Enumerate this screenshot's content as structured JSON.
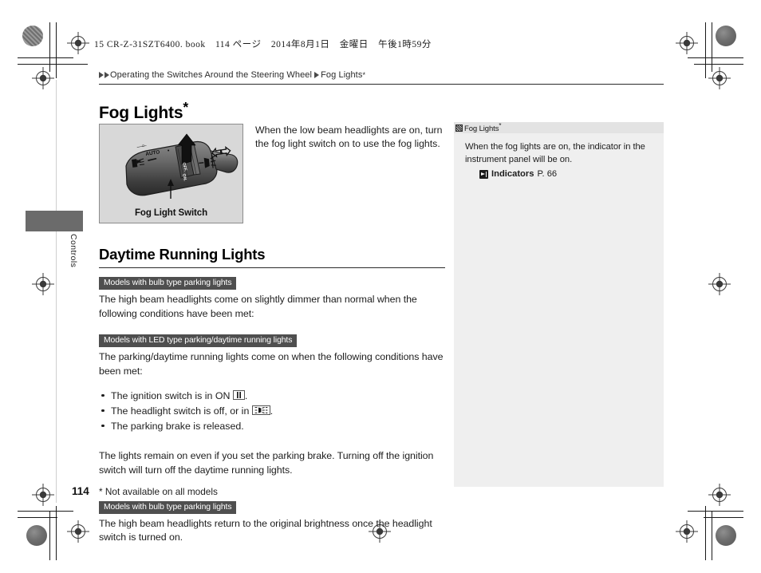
{
  "header": {
    "file_line": "15 CR-Z-31SZT6400. book   114 ページ   2014年8月1日   金曜日   午後1時59分",
    "segments": [
      "15 CR-Z-31SZT6400. book",
      "114 ページ",
      "2014年8月1日",
      "金曜日",
      "午後1時59分"
    ]
  },
  "breadcrumb": {
    "parent": "Operating the Switches Around the Steering Wheel",
    "current": "Fog Lights",
    "asterisk": "*"
  },
  "main": {
    "title": "Fog Lights",
    "title_asterisk": "*",
    "intro": "When the low beam headlights are on, turn the fog light switch on to use the fog lights.",
    "figure_caption": "Fog Light Switch",
    "figure_labels": [
      "AUTO",
      "OFF",
      "ON"
    ],
    "section2_title": "Daytime Running Lights",
    "badge_bulb": "Models with bulb type parking lights",
    "para_bulb": "The high beam headlights come on slightly dimmer than normal when the following conditions have been met:",
    "badge_led": "Models with LED type parking/daytime running lights",
    "para_led": "The parking/daytime running lights come on when the following conditions have been met:",
    "bullets": [
      {
        "pre": "The ignition switch is in ON ",
        "icon": "ignition-on-icon",
        "post": "."
      },
      {
        "pre": "The headlight switch is off, or in ",
        "icon": "parking-light-icon",
        "post": "."
      },
      {
        "pre": "The parking brake is released.",
        "icon": "",
        "post": ""
      }
    ],
    "para_remain": "The lights remain on even if you set the parking brake. Turning off the ignition switch will turn off the daytime running lights.",
    "badge_bulb2": "Models with bulb type parking lights",
    "para_bulb2": "The high beam headlights return to the original brightness once the headlight switch is turned on."
  },
  "note": {
    "title": "Fog Lights",
    "title_asterisk": "*",
    "body": "When the fog lights are on, the indicator in the instrument panel will be on.",
    "xref_label": "Indicators",
    "xref_page": "P. 66"
  },
  "sidetab": {
    "label": "Controls"
  },
  "footer": {
    "page_number": "114",
    "footnote": "* Not available on all models"
  },
  "colors": {
    "badge_bg": "#4f4f4f",
    "note_bg": "#efefef",
    "figure_bg": "#d8d8d8",
    "tab_bg": "#6b6b6b"
  }
}
